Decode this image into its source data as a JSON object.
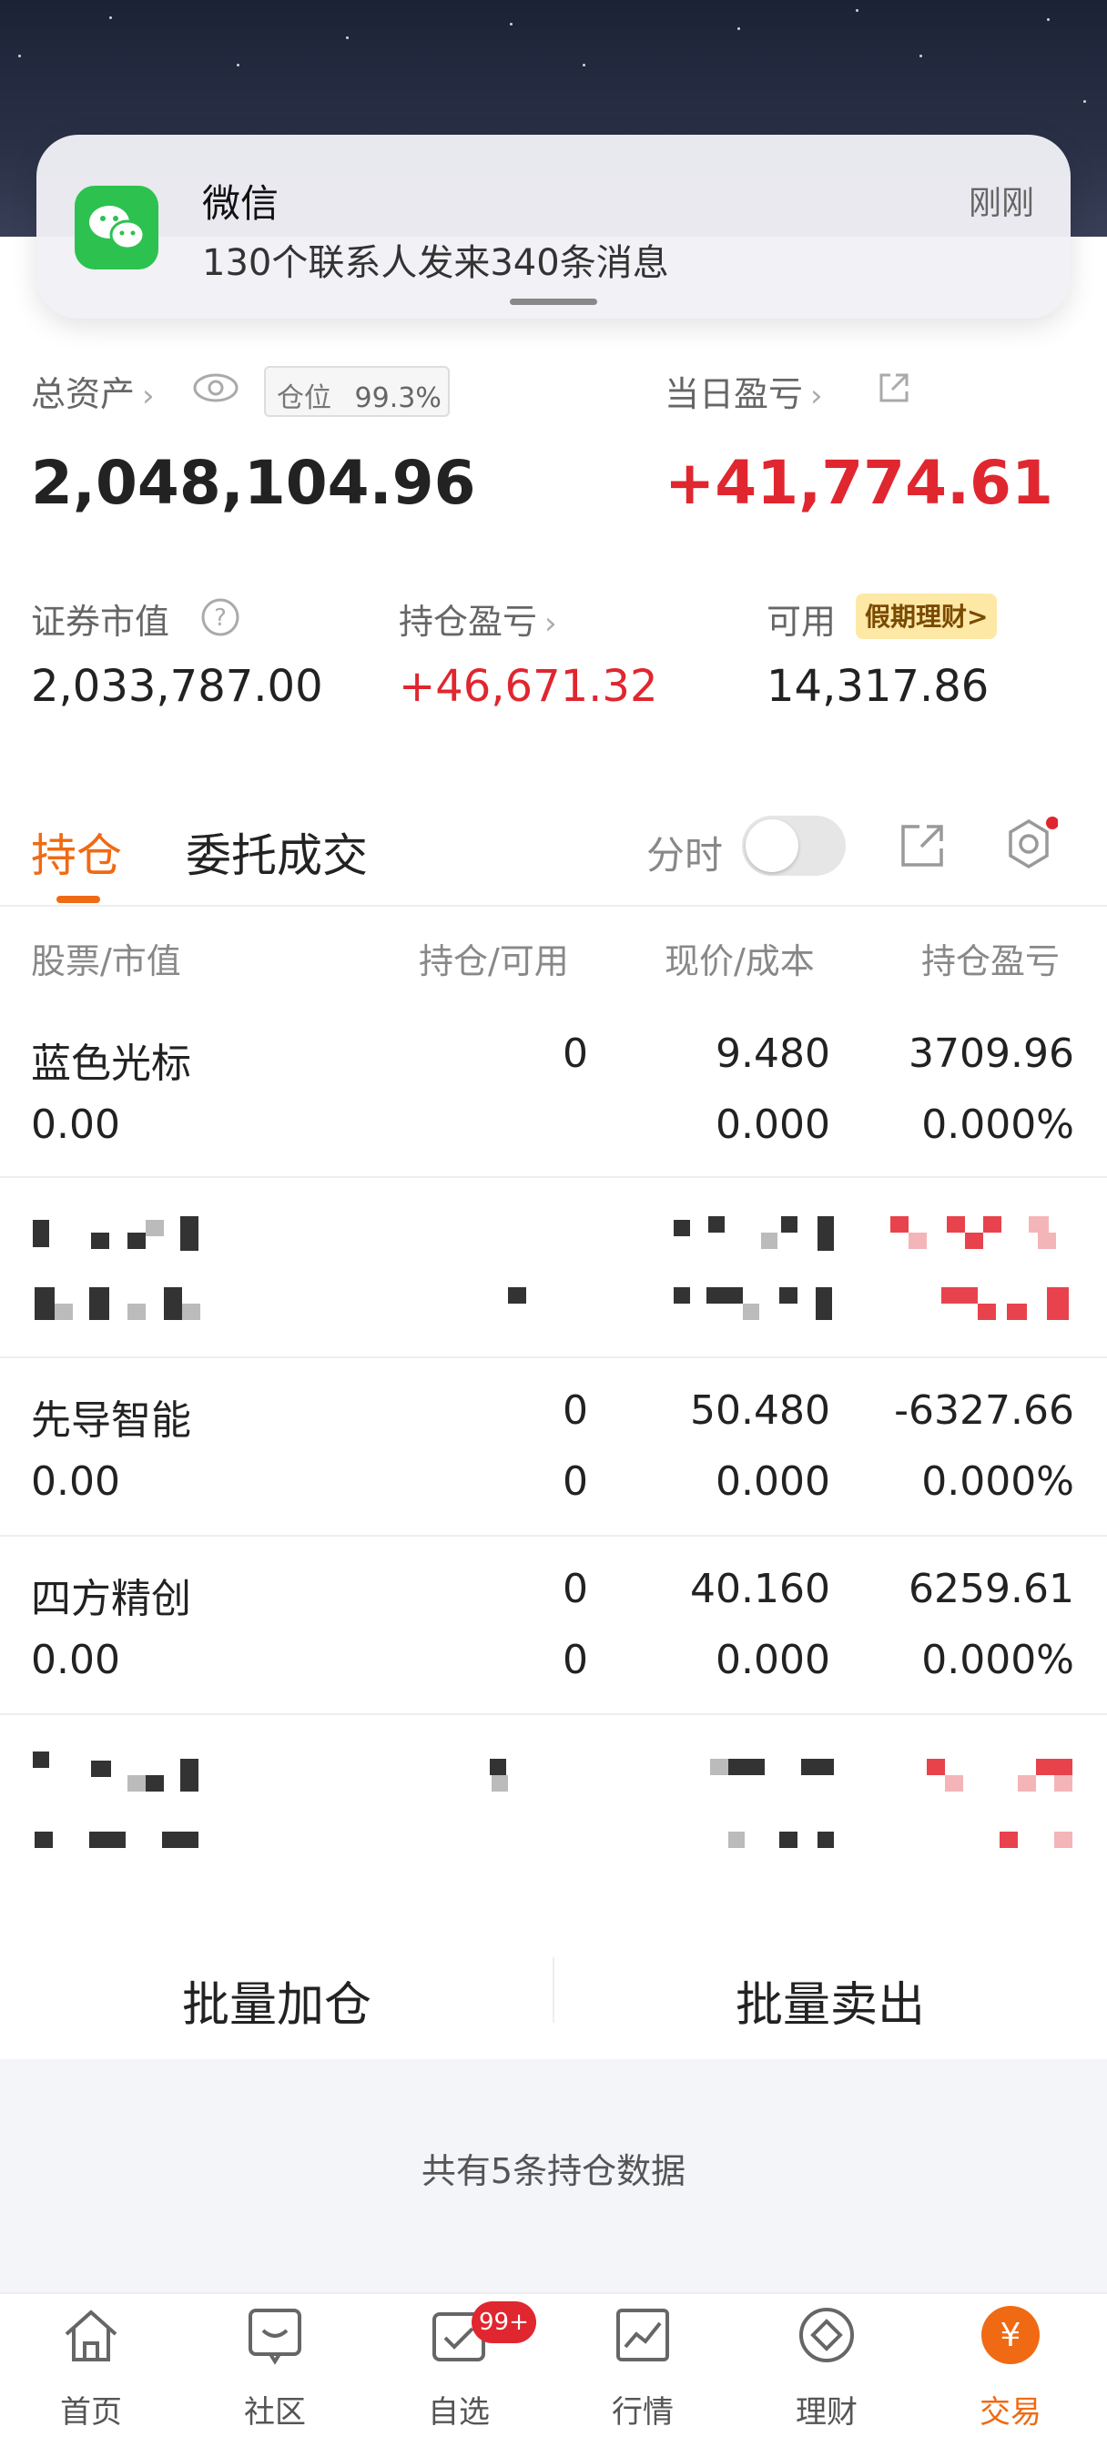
{
  "notification": {
    "app_name": "微信",
    "message": "130个联系人发来340条消息",
    "time": "刚刚"
  },
  "summary": {
    "total_assets_label": "总资产",
    "position_label": "仓位",
    "position_value": "99.3%",
    "total_assets": "2,048,104.96",
    "daily_pnl_label": "当日盈亏",
    "daily_pnl": "+41,774.61",
    "market_value_label": "证券市值",
    "market_value": "2,033,787.00",
    "holding_pnl_label": "持仓盈亏",
    "holding_pnl": "+46,671.32",
    "available_label": "可用",
    "available": "14,317.86",
    "holiday_badge": "假期理财>"
  },
  "tabs": {
    "holdings": "持仓",
    "orders": "委托成交",
    "timeshare_label": "分时"
  },
  "table": {
    "headers": [
      "股票/市值",
      "持仓/可用",
      "现价/成本",
      "持仓盈亏"
    ],
    "rows": [
      {
        "name": "蓝色光标",
        "market_value": "0.00",
        "position": "0",
        "price": "9.480",
        "cost": "0.000",
        "pnl": "3709.96",
        "pnl_pct": "0.000%"
      },
      {
        "name": "先导智能",
        "market_value": "0.00",
        "position": "0",
        "available": "0",
        "price": "50.480",
        "cost": "0.000",
        "pnl": "-6327.66",
        "pnl_pct": "0.000%"
      },
      {
        "name": "四方精创",
        "market_value": "0.00",
        "position": "0",
        "available": "0",
        "price": "40.160",
        "cost": "0.000",
        "pnl": "6259.61",
        "pnl_pct": "0.000%"
      }
    ]
  },
  "buttons": {
    "batch_add": "批量加仓",
    "batch_sell": "批量卖出"
  },
  "footer_note": "共有5条持仓数据",
  "nav": {
    "items": [
      "首页",
      "社区",
      "自选",
      "行情",
      "理财",
      "交易"
    ],
    "badge": "99+"
  },
  "colors": {
    "accent": "#f06a14",
    "up": "#e0262f",
    "down": "#1a9c2a",
    "wechat": "#2dc24f"
  }
}
